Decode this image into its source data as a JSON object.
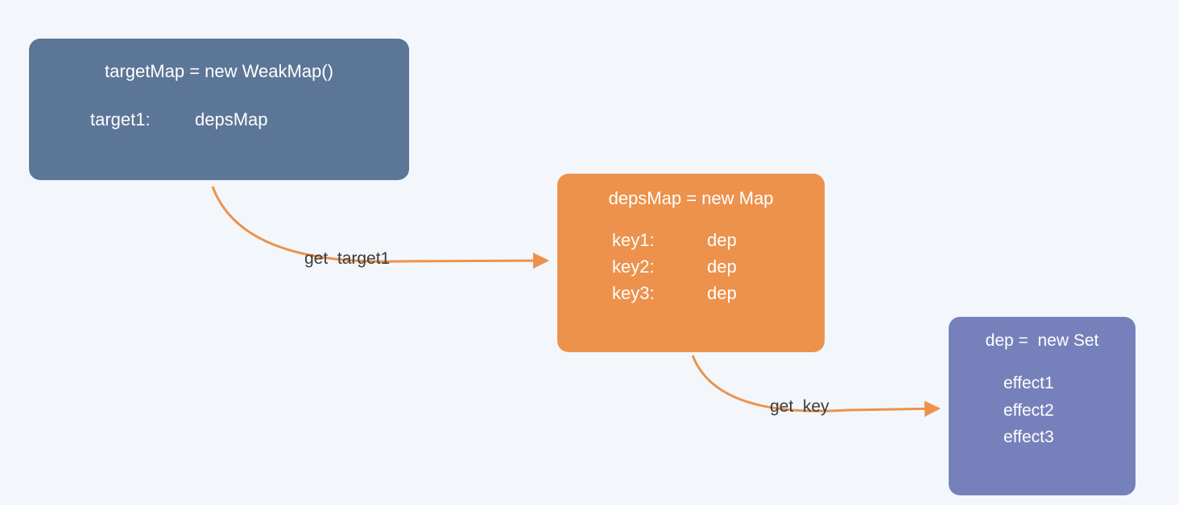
{
  "boxA": {
    "title": "targetMap = new WeakMap()",
    "rows": [
      {
        "key": "target1:",
        "val": "depsMap"
      }
    ]
  },
  "boxB": {
    "title": "depsMap = new Map",
    "rows": [
      {
        "key": "key1:",
        "val": "dep"
      },
      {
        "key": "key2:",
        "val": "dep"
      },
      {
        "key": "key3:",
        "val": "dep"
      }
    ]
  },
  "boxC": {
    "title": "dep =  new Set",
    "rows": [
      {
        "key": "effect1"
      },
      {
        "key": "effect2"
      },
      {
        "key": "effect3"
      }
    ]
  },
  "edges": {
    "label1": "get  target1",
    "label2": "get  key"
  },
  "colors": {
    "boxA": "#5c7697",
    "boxB": "#ec924c",
    "boxC": "#7681bb",
    "arrow": "#ec924c",
    "bg": "#f3f7fb"
  }
}
